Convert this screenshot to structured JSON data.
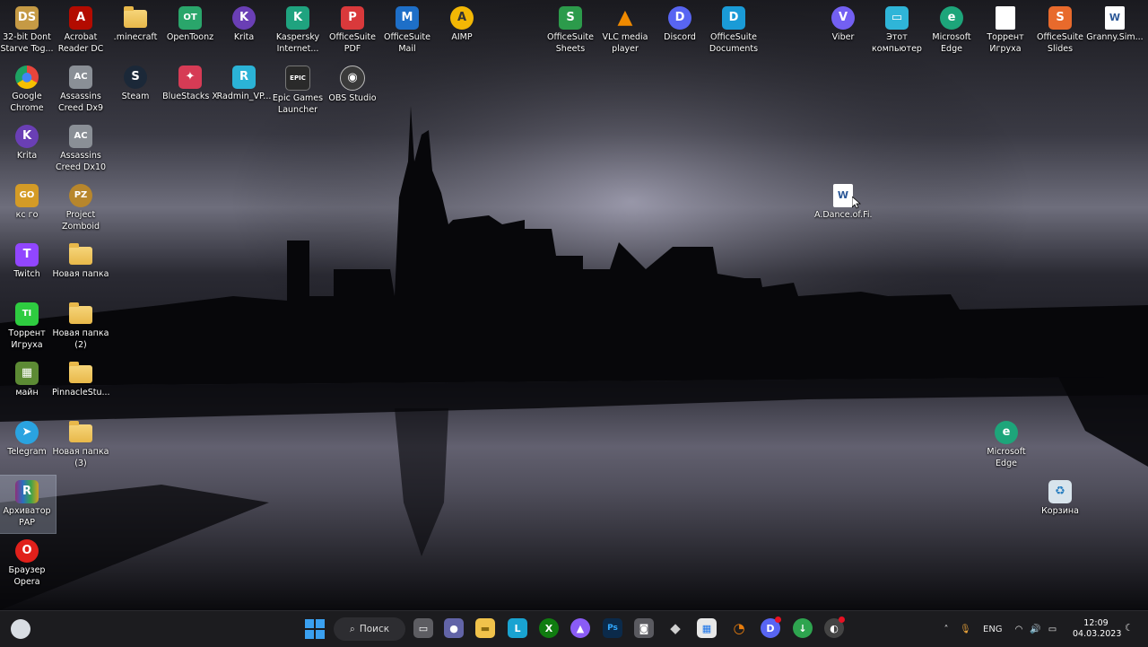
{
  "desktop_icons": {
    "i1": {
      "label": "32-bit Dont Starve Tog...",
      "icon": "dont-starve-icon",
      "color": "#c59a45",
      "glyph": "DS"
    },
    "i2": {
      "label": "Acrobat Reader DC",
      "icon": "acrobat-icon",
      "color": "#b30b00",
      "glyph": "A"
    },
    "i3": {
      "label": ".minecraft",
      "icon": "folder-icon"
    },
    "i4": {
      "label": "OpenToonz",
      "icon": "opentoonz-icon",
      "color": "#2aa66b",
      "glyph": "OT"
    },
    "i5": {
      "label": "Krita",
      "icon": "krita-icon",
      "color": "#6a3fb5",
      "glyph": "K"
    },
    "i6": {
      "label": "Kaspersky Internet...",
      "icon": "kaspersky-icon",
      "color": "#1fa37f",
      "glyph": "K"
    },
    "i7": {
      "label": "OfficeSuite PDF",
      "icon": "officesuite-pdf-icon",
      "color": "#d9393b",
      "glyph": "P"
    },
    "i8": {
      "label": "OfficeSuite Mail",
      "icon": "officesuite-mail-icon",
      "color": "#1e6fc8",
      "glyph": "M"
    },
    "i9": {
      "label": "AIMP",
      "icon": "aimp-icon",
      "color": "#f2b705",
      "glyph": "A"
    },
    "i10": {
      "label": "OfficeSuite Sheets",
      "icon": "officesuite-sheets-icon",
      "color": "#2c9b4b",
      "glyph": "S"
    },
    "i11": {
      "label": "VLC media player",
      "icon": "vlc-icon",
      "color": "#f08a00",
      "glyph": "▲"
    },
    "i12": {
      "label": "Discord",
      "icon": "discord-icon",
      "color": "#5865f2",
      "glyph": "D"
    },
    "i13": {
      "label": "OfficeSuite Documents",
      "icon": "officesuite-documents-icon",
      "color": "#1a9bd7",
      "glyph": "D"
    },
    "i14": {
      "label": "Viber",
      "icon": "viber-icon",
      "color": "#7360f2",
      "glyph": "V"
    },
    "i15": {
      "label": "Этот компьютер",
      "icon": "computer-icon",
      "color": "#2fb5d8",
      "glyph": "▭"
    },
    "i16": {
      "label": "Microsoft Edge",
      "icon": "edge-icon",
      "color": "#1da57a",
      "glyph": "e"
    },
    "i17": {
      "label": "Торрент Игруха",
      "icon": "document-icon"
    },
    "i18": {
      "label": "OfficeSuite Slides",
      "icon": "officesuite-slides-icon",
      "color": "#e86a2c",
      "glyph": "S"
    },
    "i19": {
      "label": "Granny.Sim...",
      "icon": "word-doc-icon",
      "glyph": "W"
    },
    "i20": {
      "label": "Google Chrome",
      "icon": "chrome-icon",
      "color": "#e8453c",
      "glyph": "●"
    },
    "i21": {
      "label": "Assassins Creed Dx9",
      "icon": "assassins-creed-icon",
      "color": "#8a8f96",
      "glyph": "AC"
    },
    "i22": {
      "label": "Steam",
      "icon": "steam-icon",
      "color": "#1b2838",
      "glyph": "S"
    },
    "i23": {
      "label": "BlueStacks X",
      "icon": "bluestacks-icon",
      "color": "#d63b55",
      "glyph": "✦"
    },
    "i24": {
      "label": "Radmin_VP...",
      "icon": "radmin-vpn-icon",
      "color": "#2bb3d6",
      "glyph": "R"
    },
    "i25": {
      "label": "Epic Games Launcher",
      "icon": "epic-games-icon",
      "color": "#2a2a2a",
      "glyph": "EPIC"
    },
    "i26": {
      "label": "OBS Studio",
      "icon": "obs-icon",
      "color": "#3a3a3a",
      "glyph": "◉"
    },
    "i27": {
      "label": "Krita",
      "icon": "krita-icon",
      "color": "#6a3fb5",
      "glyph": "K"
    },
    "i28": {
      "label": "Assassins Creed Dx10",
      "icon": "assassins-creed-icon",
      "color": "#8a8f96",
      "glyph": "AC"
    },
    "i29": {
      "label": "кс го",
      "icon": "csgo-icon",
      "color": "#d49b26",
      "glyph": "GO"
    },
    "i30": {
      "label": "Project Zomboid",
      "icon": "project-zomboid-icon",
      "color": "#b7862c",
      "glyph": "PZ"
    },
    "i31": {
      "label": "Twitch",
      "icon": "twitch-icon",
      "color": "#9146ff",
      "glyph": "T"
    },
    "i32": {
      "label": "Новая папка",
      "icon": "folder-icon"
    },
    "i33": {
      "label": "Торрент Игруха",
      "icon": "torrent-igruha-icon",
      "color": "#2ecc40",
      "glyph": "TI"
    },
    "i34": {
      "label": "Новая папка (2)",
      "icon": "folder-icon"
    },
    "i35": {
      "label": "майн",
      "icon": "minecraft-icon",
      "color": "#5c8a34",
      "glyph": "▦"
    },
    "i36": {
      "label": "PinnacleStu...",
      "icon": "folder-icon"
    },
    "i37": {
      "label": "Telegram",
      "icon": "telegram-icon",
      "color": "#2aa3e0",
      "glyph": "➤"
    },
    "i38": {
      "label": "Новая папка (3)",
      "icon": "folder-icon"
    },
    "i39": {
      "label": "Архиватор РАР",
      "icon": "winrar-icon",
      "color": "#8e2f7a",
      "glyph": "R"
    },
    "i40": {
      "label": "Браузер Opera",
      "icon": "opera-icon",
      "color": "#e0201b",
      "glyph": "O"
    },
    "i41": {
      "label": "A.Dance.of.Fi...",
      "icon": "word-doc-icon",
      "glyph": "W"
    },
    "i42": {
      "label": "Microsoft Edge",
      "icon": "edge-icon",
      "color": "#1da57a",
      "glyph": "e"
    },
    "i43": {
      "label": "Корзина",
      "icon": "recycle-bin-icon",
      "color": "#d8e4ec",
      "glyph": "♻"
    }
  },
  "taskbar": {
    "search_label": "Поиск",
    "items": {
      "t1": {
        "icon": "task-view-icon",
        "color": "#5d5d62",
        "glyph": "▭"
      },
      "t2": {
        "icon": "teams-chat-icon",
        "color": "#6264a7",
        "glyph": "●"
      },
      "t3": {
        "icon": "file-explorer-icon",
        "color": "#f0c24b",
        "glyph": "▬"
      },
      "t4": {
        "icon": "l-app-icon",
        "color": "#19a3d1",
        "glyph": "L"
      },
      "t5": {
        "icon": "xbox-icon",
        "color": "#107c10",
        "glyph": "X"
      },
      "t6": {
        "icon": "purple-app-icon",
        "color": "#8a5cf6",
        "glyph": "▲"
      },
      "t7": {
        "icon": "photoshop-icon",
        "color": "#0b2a4a",
        "glyph": "Ps"
      },
      "t8": {
        "icon": "camera-icon",
        "color": "#5a5a60",
        "glyph": "◙"
      },
      "t9": {
        "icon": "roblox-icon",
        "color": "#d0d0d0",
        "glyph": "◆"
      },
      "t10": {
        "icon": "microsoft-store-icon",
        "color": "#e8e8e8",
        "glyph": "▦"
      },
      "t11": {
        "icon": "blender-icon",
        "color": "#e87d0d",
        "glyph": "◔"
      },
      "t12": {
        "icon": "discord-icon",
        "color": "#5865f2",
        "glyph": "D"
      },
      "t13": {
        "icon": "green-download-icon",
        "color": "#2ea44f",
        "glyph": "↓"
      },
      "t14": {
        "icon": "steam-notify-icon",
        "color": "#444",
        "glyph": "◐"
      }
    },
    "language": "ENG",
    "time": "12:09",
    "date": "04.03.2023"
  }
}
